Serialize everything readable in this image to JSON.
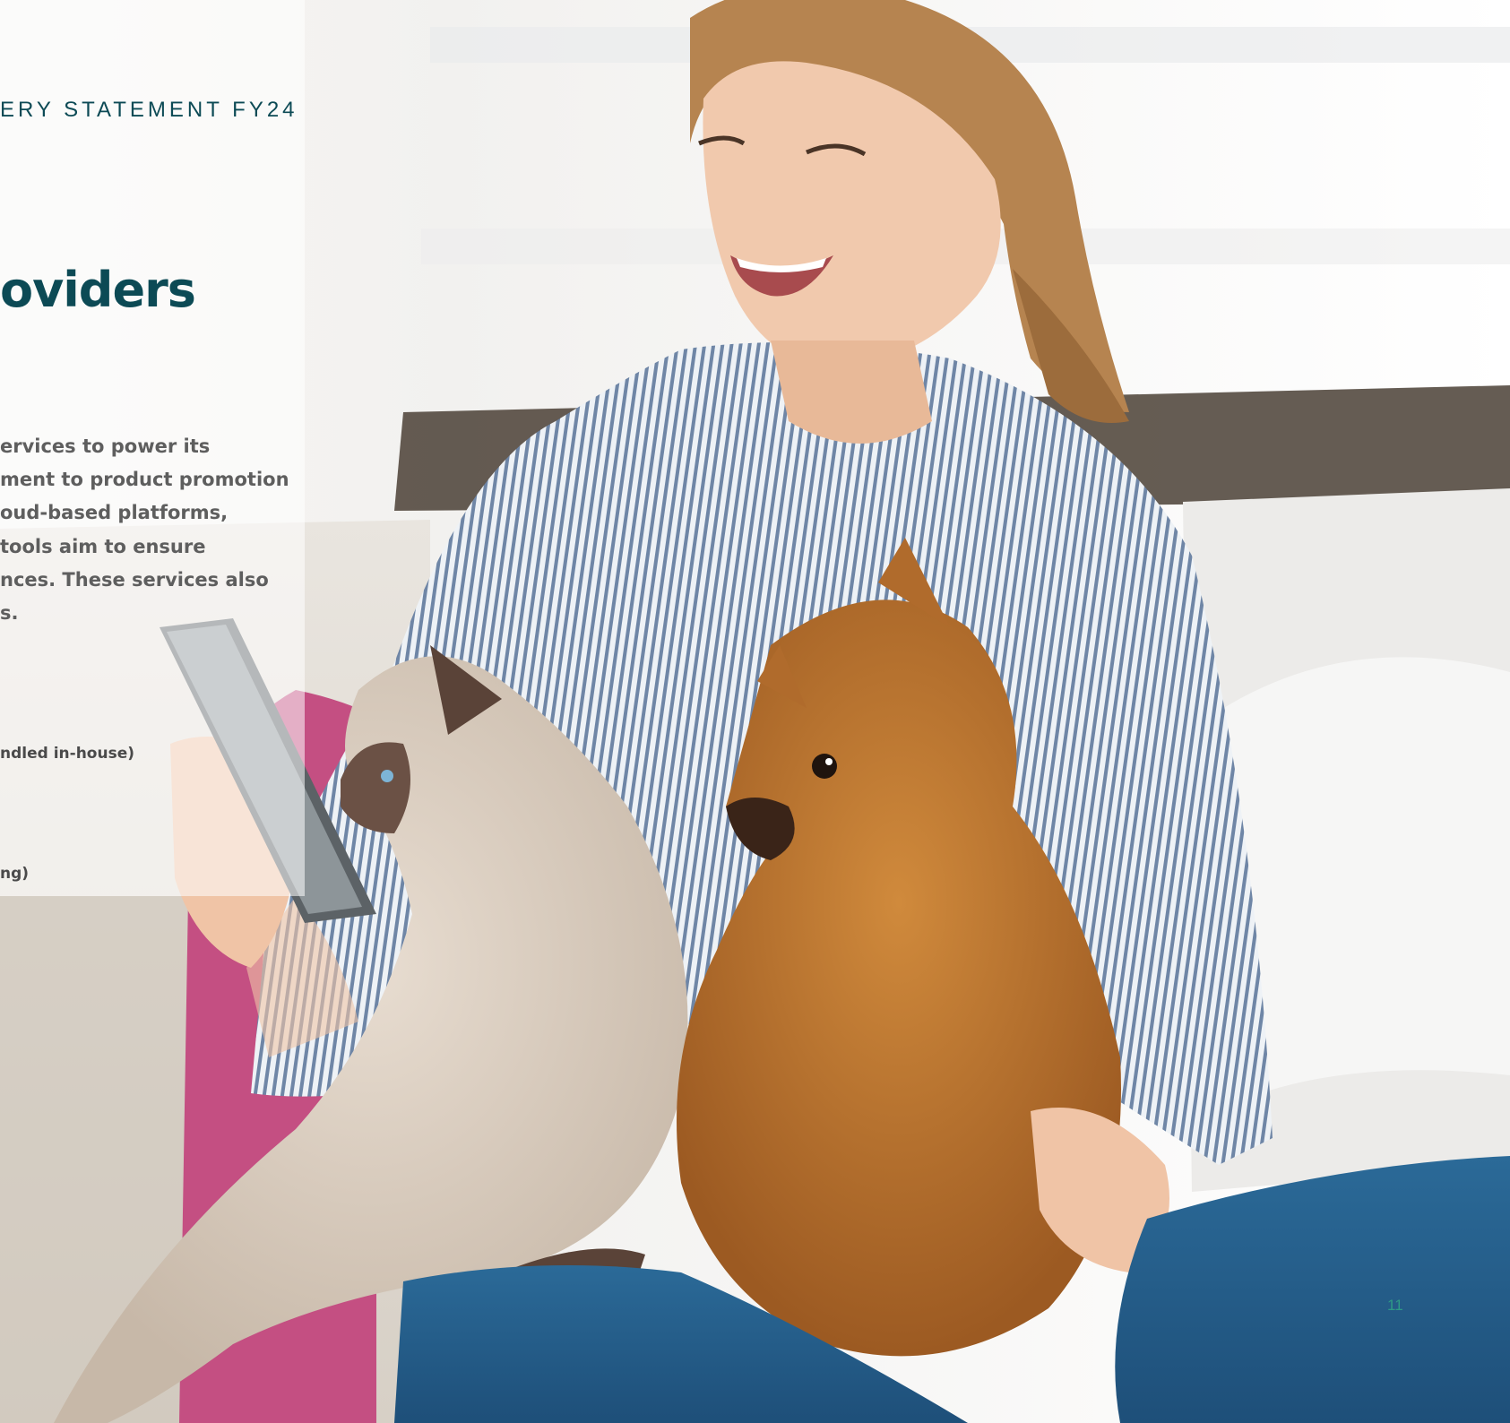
{
  "header": {
    "title": "ERY STATEMENT FY24"
  },
  "heading": "oviders",
  "paragraph_lines": [
    "ervices to power its",
    "ment to product promotion",
    "oud-based platforms,",
    "tools aim to ensure",
    "nces. These services also",
    "s."
  ],
  "list_fragments": [
    "ndled in-house)",
    "ng)"
  ],
  "page_number": "11",
  "colors": {
    "heading": "#0c4a55",
    "body_text": "#5e5e5e",
    "page_number": "#2e9a86"
  }
}
